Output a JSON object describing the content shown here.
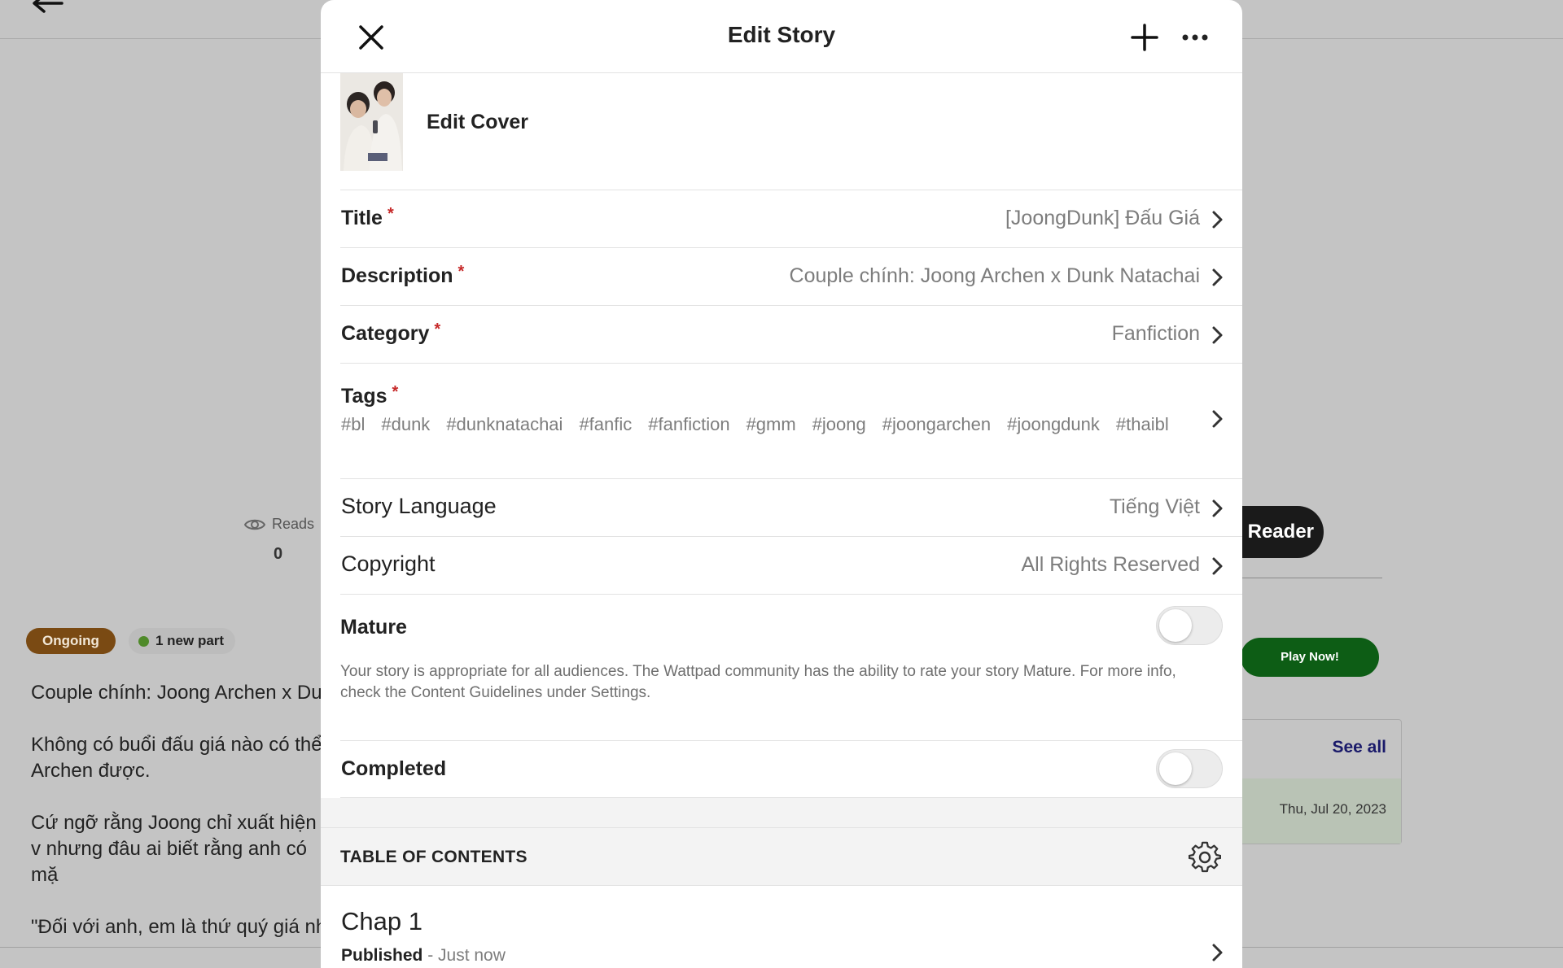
{
  "background": {
    "reads_label": "Reads",
    "reads_count": "0",
    "status_badge": "Ongoing",
    "new_part_badge": "1 new part",
    "description_paragraphs": [
      "Couple chính: Joong Archen x Dunk Natachai",
      "Không có buổi đấu giá nào có thể Archen được.",
      "Cứ ngỡ rằng Joong chỉ xuất hiện v nhưng đâu ai biết rằng anh có mặ",
      "\"Đối với anh, em là thứ quý giá nh"
    ],
    "reader_button": "s Reader",
    "play_button": "Play Now!",
    "see_all": "See all",
    "card_date": "Thu, Jul 20, 2023"
  },
  "modal": {
    "title": "Edit Story",
    "cover_label": "Edit Cover",
    "fields": {
      "title": {
        "label": "Title",
        "value": "[JoongDunk] Đấu Giá"
      },
      "description": {
        "label": "Description",
        "value": "Couple chính: Joong Archen x Dunk Natachai"
      },
      "category": {
        "label": "Category",
        "value": "Fanfiction"
      },
      "language": {
        "label": "Story Language",
        "value": "Tiếng Việt"
      },
      "copyright": {
        "label": "Copyright",
        "value": "All Rights Reserved"
      }
    },
    "required_marker": "*",
    "tags_label": "Tags",
    "tags": [
      "#bl",
      "#dunk",
      "#dunknatachai",
      "#fanfic",
      "#fanfiction",
      "#gmm",
      "#joong",
      "#joongarchen",
      "#joongdunk",
      "#thaibl"
    ],
    "mature": {
      "label": "Mature",
      "enabled": false,
      "description": "Your story is appropriate for all audiences. The Wattpad community has the ability to rate your story Mature. For more info, check the Content Guidelines under Settings."
    },
    "completed": {
      "label": "Completed",
      "enabled": false
    },
    "toc": {
      "title": "TABLE OF CONTENTS",
      "chapters": [
        {
          "title": "Chap 1",
          "status": "Published",
          "time": " - Just now"
        }
      ]
    }
  },
  "icons": {
    "close": "close-icon",
    "add": "plus-icon",
    "more": "more-horizontal-icon",
    "chevron": "chevron-right-icon",
    "gear": "gear-icon",
    "back": "arrow-left-icon",
    "eye": "eye-icon"
  },
  "colors": {
    "required": "#c62828",
    "ongoing_badge": "#7a4a13",
    "play_button": "#0d5d15",
    "overlay_background": "#c4c4c4"
  }
}
